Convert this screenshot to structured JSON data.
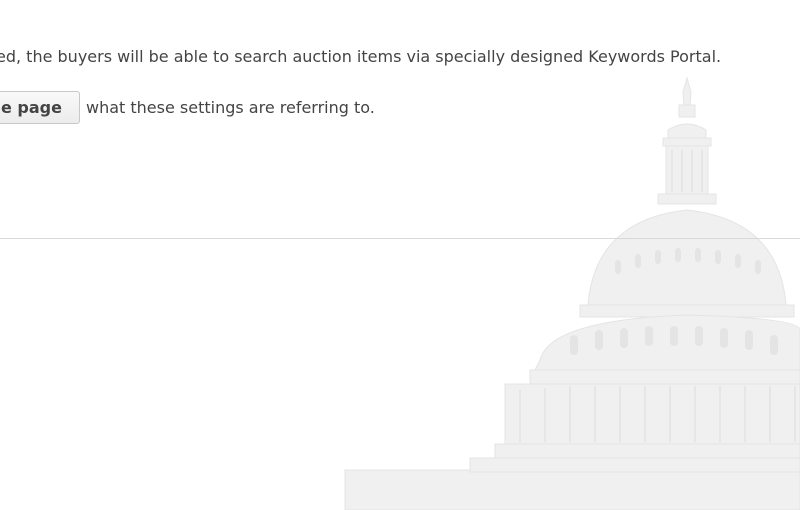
{
  "content": {
    "intro_text": "ed, the buyers will be able to search auction items via specially designed Keywords Portal.",
    "guide_button_label": "e page",
    "guide_trailing_text": "what these settings are referring to."
  },
  "colors": {
    "text": "#444444",
    "divider": "#d9d9d9",
    "watermark": "#ebebeb",
    "background": "#ffffff"
  },
  "icons": {
    "background_watermark": "capitol-building-icon"
  }
}
